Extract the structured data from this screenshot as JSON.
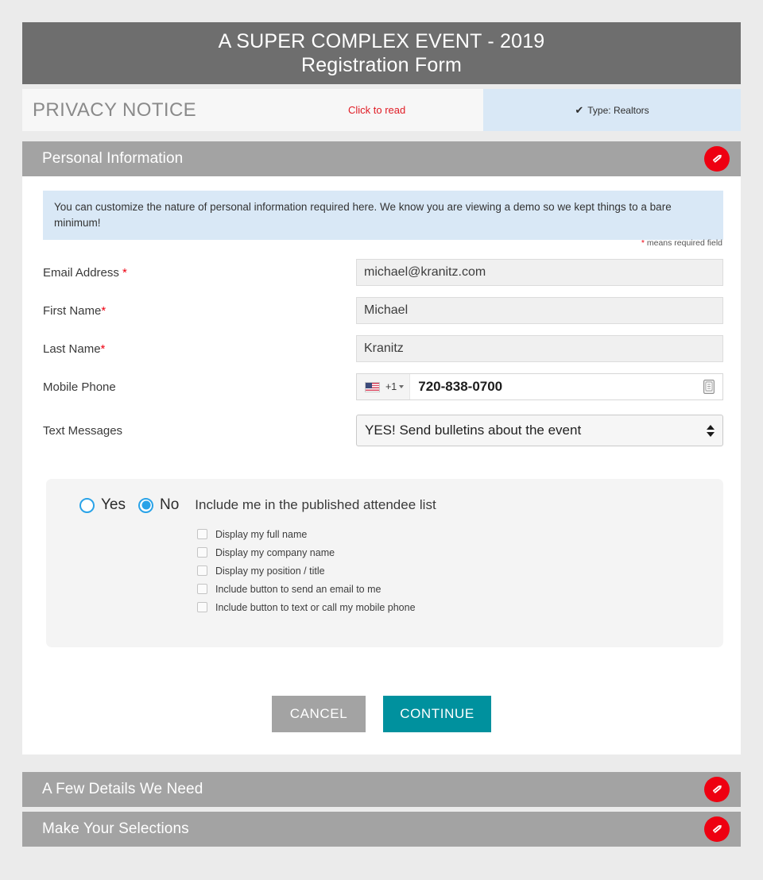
{
  "header": {
    "event_title": "A SUPER COMPLEX EVENT - 2019",
    "form_subtitle": "Registration Form"
  },
  "privacy_bar": {
    "title": "PRIVACY NOTICE",
    "link_label": "Click to read",
    "type_badge": {
      "check_icon": "check-icon",
      "label": "Type: Realtors"
    }
  },
  "sections": {
    "personal": {
      "title": "Personal Information",
      "edit_icon": "pencil-icon"
    },
    "details": {
      "title": "A Few Details We Need",
      "edit_icon": "pencil-icon"
    },
    "selections": {
      "title": "Make Your Selections",
      "edit_icon": "pencil-icon"
    }
  },
  "info_box": {
    "text": "You can customize the nature of personal information required here.  We know you are viewing a demo so we kept things to a bare minimum!"
  },
  "required_note": {
    "star": "*",
    "text": " means required field"
  },
  "fields": {
    "email": {
      "label": "Email Address ",
      "star": "*",
      "value": "michael@kranitz.com",
      "placeholder": "Email Address"
    },
    "first_name": {
      "label": "First Name",
      "star": "*",
      "value": "Michael",
      "placeholder": "First Name"
    },
    "last_name": {
      "label": "Last Name",
      "star": "*",
      "value": "Kranitz",
      "placeholder": "Last Name"
    },
    "mobile_phone": {
      "label": "Mobile Phone",
      "flag_icon": "us-flag-icon",
      "country_code": "+1",
      "value": "720-838-0700",
      "placeholder": "Mobile Phone",
      "trailing_icon": "phone-card-icon"
    },
    "text_messages": {
      "label": "Text Messages",
      "selected": "YES! Send bulletins about the event"
    }
  },
  "attendee": {
    "radio_yes_label": "Yes",
    "radio_no_label": "No",
    "radio_selected": "No",
    "question": "Include me in the published attendee list",
    "options": [
      {
        "label": "Display my full name",
        "checked": false
      },
      {
        "label": "Display my company name",
        "checked": false
      },
      {
        "label": "Display my position / title",
        "checked": false
      },
      {
        "label": "Include button to send an email to me",
        "checked": false
      },
      {
        "label": "Include button to text or call my mobile phone",
        "checked": false
      }
    ]
  },
  "buttons": {
    "cancel": "CANCEL",
    "continue": "CONTINUE"
  },
  "colors": {
    "title_bar": "#6e6e6e",
    "section_header": "#a3a3a3",
    "accent_red": "#ee0011",
    "accent_teal": "#00919e",
    "info_blue": "#d9e8f6",
    "radio_blue": "#2aa3e8",
    "page_background": "#ebebeb"
  }
}
